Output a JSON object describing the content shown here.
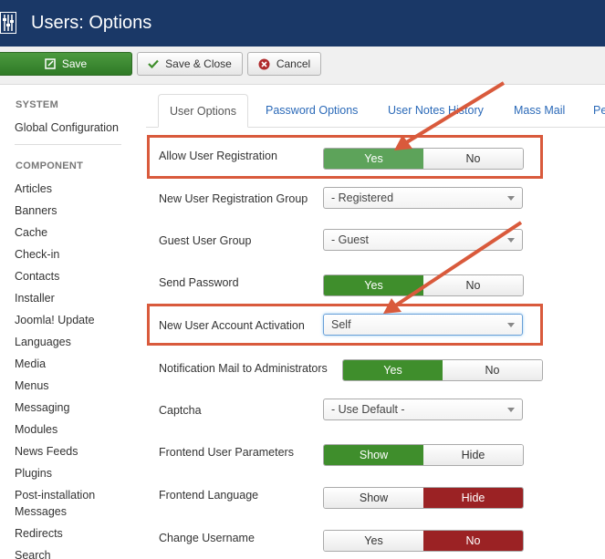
{
  "header": {
    "title": "Users: Options"
  },
  "toolbar": {
    "save": "Save",
    "save_close": "Save & Close",
    "cancel": "Cancel"
  },
  "sidebar": {
    "system_heading": "SYSTEM",
    "global_config": "Global Configuration",
    "component_heading": "COMPONENT",
    "items": [
      "Articles",
      "Banners",
      "Cache",
      "Check-in",
      "Contacts",
      "Installer",
      "Joomla! Update",
      "Languages",
      "Media",
      "Menus",
      "Messaging",
      "Modules",
      "News Feeds",
      "Plugins",
      "Post-installation Messages",
      "Redirects",
      "Search"
    ]
  },
  "tabs": [
    "User Options",
    "Password Options",
    "User Notes History",
    "Mass Mail",
    "Pe"
  ],
  "form": {
    "allow_registration": {
      "label": "Allow User Registration",
      "yes": "Yes",
      "no": "No",
      "selected": "Yes"
    },
    "registration_group": {
      "label": "New User Registration Group",
      "value": "- Registered"
    },
    "guest_group": {
      "label": "Guest User Group",
      "value": "- Guest"
    },
    "send_password": {
      "label": "Send Password",
      "yes": "Yes",
      "no": "No",
      "selected": "Yes"
    },
    "account_activation": {
      "label": "New User Account Activation",
      "value": "Self"
    },
    "notification_mail": {
      "label": "Notification Mail to Administrators",
      "yes": "Yes",
      "no": "No",
      "selected": "Yes"
    },
    "captcha": {
      "label": "Captcha",
      "value": "- Use Default -"
    },
    "frontend_params": {
      "label": "Frontend User Parameters",
      "show": "Show",
      "hide": "Hide",
      "selected": "Show"
    },
    "frontend_language": {
      "label": "Frontend Language",
      "show": "Show",
      "hide": "Hide",
      "selected": "Hide"
    },
    "change_username": {
      "label": "Change Username",
      "yes": "Yes",
      "no": "No",
      "selected": "No"
    }
  },
  "colors": {
    "header_bg": "#1a3867",
    "highlight": "#d95a3c",
    "green": "#3f8e2c",
    "red": "#9b2224",
    "link": "#2a69b8"
  },
  "icons": [
    "joomla-options-icon",
    "edit-icon",
    "check-icon",
    "cancel-circle-icon"
  ]
}
